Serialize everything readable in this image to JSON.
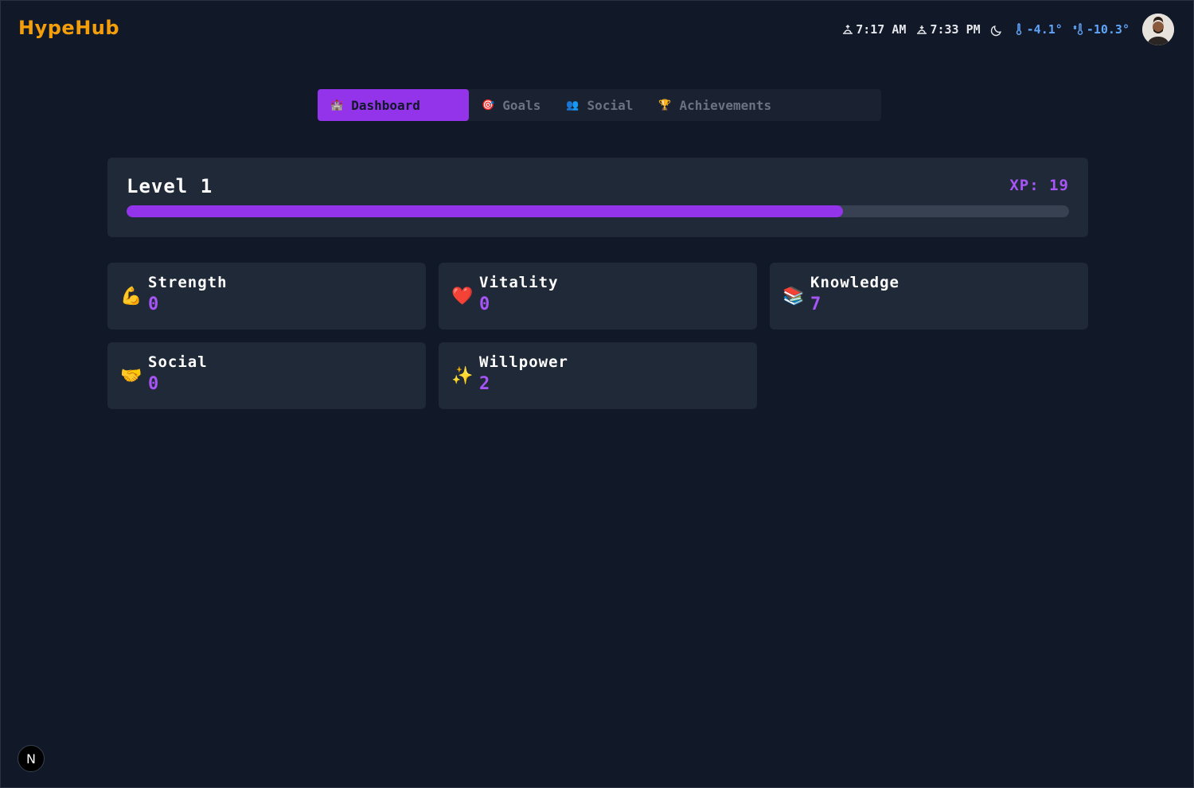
{
  "app": {
    "logo": "HypeHub"
  },
  "topbar": {
    "sunrise": "7:17 AM",
    "sunset": "7:33 PM",
    "temperature": "-4.1°",
    "feels_like": "-10.3°",
    "icons": [
      "sunrise-icon",
      "sunset-icon",
      "moon-icon",
      "thermometer-icon",
      "wind-chill-icon",
      "avatar"
    ]
  },
  "tabs": [
    {
      "icon": "🏰",
      "label": "Dashboard",
      "active": true
    },
    {
      "icon": "🎯",
      "label": "Goals",
      "active": false
    },
    {
      "icon": "👥",
      "label": "Social",
      "active": false
    },
    {
      "icon": "🏆",
      "label": "Achievements",
      "active": false
    }
  ],
  "level": {
    "title": "Level 1",
    "xp_label": "XP: 19",
    "xp_progress": 0.76
  },
  "stats": [
    {
      "icon": "💪",
      "name": "Strength",
      "value": "0"
    },
    {
      "icon": "❤️",
      "name": "Vitality",
      "value": "0"
    },
    {
      "icon": "📚",
      "name": "Knowledge",
      "value": "7"
    },
    {
      "icon": "🤝",
      "name": "Social",
      "value": "0"
    },
    {
      "icon": "✨",
      "name": "Willpower",
      "value": "2"
    }
  ],
  "badge": {
    "label": "N"
  },
  "colors": {
    "background": "#111827",
    "card": "#1f2937",
    "accent": "#9333ea",
    "accent_text": "#a855f7",
    "logo": "#f59e0b",
    "temperature": "#60a5fa"
  }
}
